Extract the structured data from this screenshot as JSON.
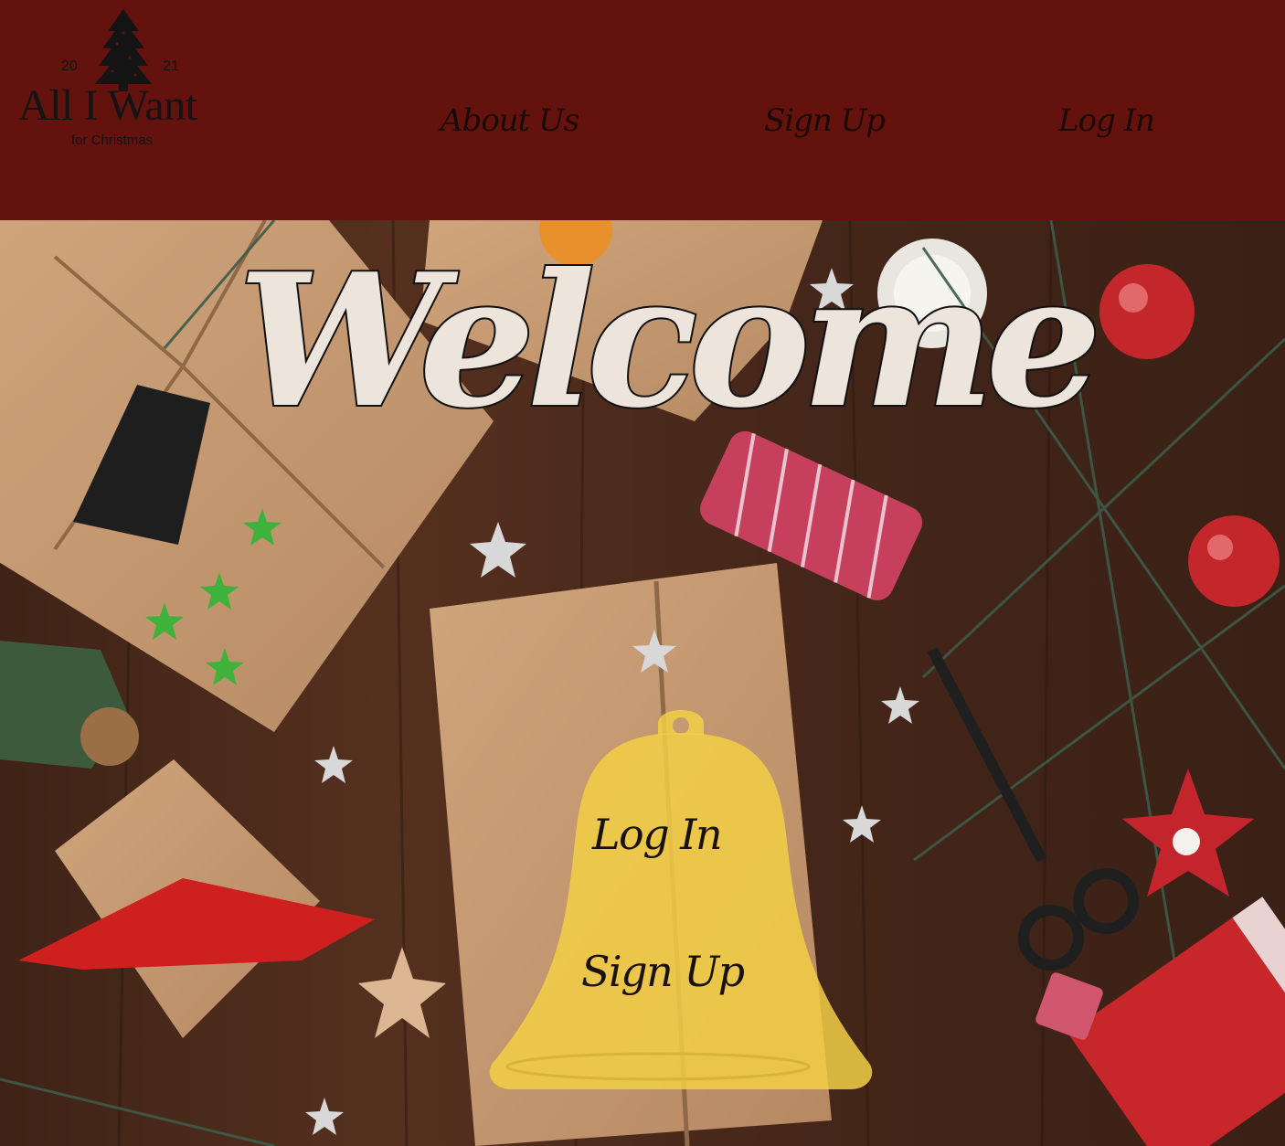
{
  "logo": {
    "year_left": "20",
    "year_right": "21",
    "brand_main": "All I Want",
    "brand_sub": "for  Christmas",
    "icon": "christmas-tree-icon"
  },
  "nav": {
    "about_label": "About Us",
    "signup_label": "Sign Up",
    "login_label": "Log In"
  },
  "hero": {
    "welcome_text": "Welcome",
    "bell": {
      "icon": "bell-icon",
      "login_label": "Log In",
      "signup_label": "Sign Up"
    }
  },
  "colors": {
    "header_bg": "#63120d",
    "bell_fill": "#f2cf45",
    "welcome_fill": "#ede4dc",
    "wood_bg": "#4a2a1c",
    "kraft_paper": "#c49a73"
  }
}
